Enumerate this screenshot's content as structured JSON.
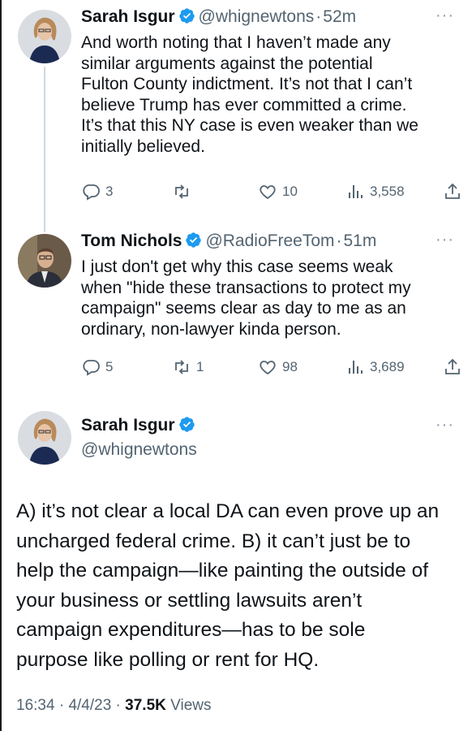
{
  "tweets": [
    {
      "name": "Sarah Isgur",
      "handle": "@whignewtons",
      "dot": "·",
      "time": "52m",
      "text": "And worth noting that I haven’t made any\nsimilar arguments against the potential\nFulton County indictment. It’s not that I can’t\nbelieve Trump has ever committed a crime.\nIt’s that this NY case is even weaker than we\ninitially believed.",
      "replies": "3",
      "retweets": "",
      "likes": "10",
      "views": "3,558"
    },
    {
      "name": "Tom Nichols",
      "handle": "@RadioFreeTom",
      "dot": "·",
      "time": "51m",
      "text": "I just don't get why this case seems weak\nwhen \"hide these transactions to protect my\ncampaign\" seems clear as day to me as an\nordinary, non-lawyer kinda person.",
      "replies": "5",
      "retweets": "1",
      "likes": "98",
      "views": "3,689"
    }
  ],
  "main": {
    "name": "Sarah Isgur",
    "handle": "@whignewtons",
    "text": "A) it’s not clear a local DA can even prove up an\nuncharged federal crime. B) it can’t just be to\nhelp the campaign—like painting the outside of\nyour business or settling lawsuits aren’t\ncampaign expenditures—has to be sole\npurpose like polling or rent for HQ.",
    "time": "16:34",
    "sep1": "·",
    "date": "4/4/23",
    "sep2": "·",
    "views_count": "37.5K",
    "views_label": "Views"
  },
  "more_label": "···",
  "colors": {
    "verified": "#1d9bf0",
    "muted": "#536471",
    "text": "#0f1419",
    "thread_line": "#cfd9de"
  },
  "icons": [
    "verified-badge-icon",
    "reply-icon",
    "retweet-icon",
    "like-icon",
    "views-icon",
    "share-icon",
    "more-icon"
  ]
}
